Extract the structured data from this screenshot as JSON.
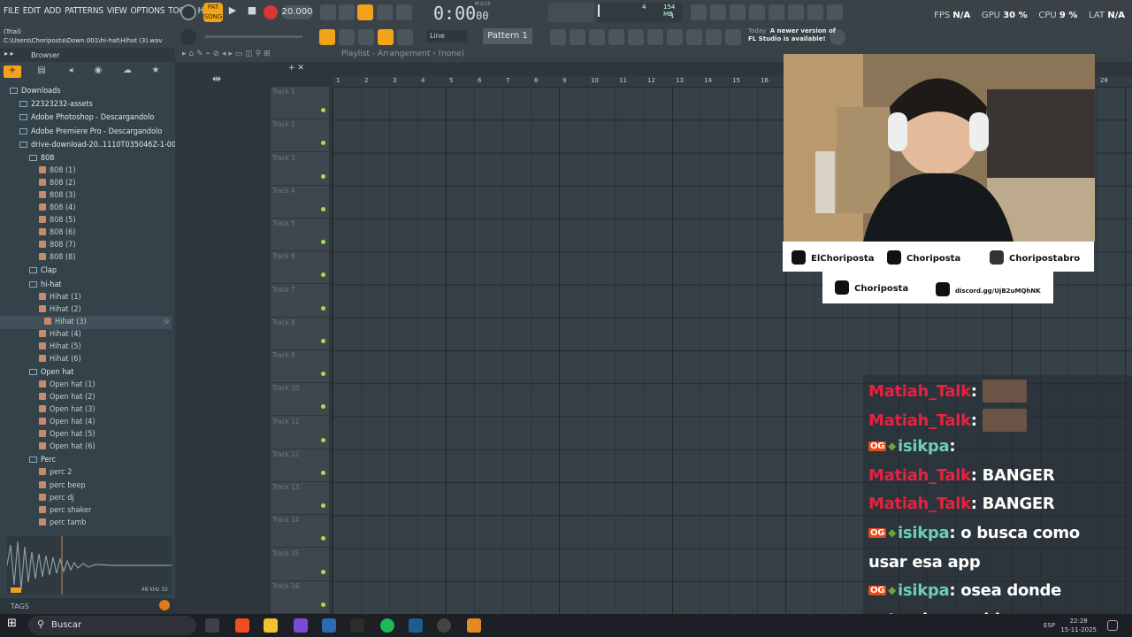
{
  "menubar": {
    "items": [
      "FILE",
      "EDIT",
      "ADD",
      "PATTERNS",
      "VIEW",
      "OPTIONS",
      "TOOLS",
      "HELP"
    ],
    "pat_song": "PAT\nSONG",
    "tempo": "20.000",
    "time": "0:00",
    "time_small": "00",
    "mcs_label": "M:S:CS",
    "memory": "154 MB",
    "cpu_numbers": [
      "4",
      "1"
    ],
    "stats": {
      "fps_label": "FPS",
      "fps": "N/A",
      "gpu_label": "GPU",
      "gpu": "30 %",
      "cpu_label": "CPU",
      "cpu": "9 %",
      "lat_label": "LAT",
      "lat": "N/A"
    }
  },
  "toolbar2": {
    "trial": "(Trial)",
    "path": "C:\\Users\\Choriposta\\Down.001\\hi-hat\\Hihat (3).wav",
    "line_mode": "Line",
    "pattern": "Pattern 1",
    "hint_day": "Today",
    "hint_text": "A newer version of",
    "hint_text2": "FL Studio is available!"
  },
  "browser": {
    "title": "Browser",
    "tags": "TAGS",
    "tree": [
      {
        "label": "Downloads",
        "type": "folder",
        "indent": 1
      },
      {
        "label": "22323232-assets",
        "type": "folder",
        "indent": 2
      },
      {
        "label": "Adobe Photoshop - Descargandolo",
        "type": "folder",
        "indent": 2
      },
      {
        "label": "Adobe Premiere Pro - Descargandolo",
        "type": "folder",
        "indent": 2
      },
      {
        "label": "drive-download-20..1110T035046Z-1-001",
        "type": "folder",
        "indent": 2
      },
      {
        "label": "808",
        "type": "folder",
        "indent": 3
      },
      {
        "label": "808 (1)",
        "type": "audio",
        "indent": 4
      },
      {
        "label": "808 (2)",
        "type": "audio",
        "indent": 4
      },
      {
        "label": "808 (3)",
        "type": "audio",
        "indent": 4
      },
      {
        "label": "808 (4)",
        "type": "audio",
        "indent": 4
      },
      {
        "label": "808 (5)",
        "type": "audio",
        "indent": 4
      },
      {
        "label": "808 (6)",
        "type": "audio",
        "indent": 4
      },
      {
        "label": "808 (7)",
        "type": "audio",
        "indent": 4
      },
      {
        "label": "808 (8)",
        "type": "audio",
        "indent": 4
      },
      {
        "label": "Clap",
        "type": "folder",
        "indent": 3
      },
      {
        "label": "hi-hat",
        "type": "folder",
        "indent": 3
      },
      {
        "label": "Hihat (1)",
        "type": "audio",
        "indent": 4
      },
      {
        "label": "Hihat (2)",
        "type": "audio",
        "indent": 4
      },
      {
        "label": "Hihat (3)",
        "type": "audio",
        "indent": 4,
        "selected": true
      },
      {
        "label": "Hihat (4)",
        "type": "audio",
        "indent": 4
      },
      {
        "label": "Hihat (5)",
        "type": "audio",
        "indent": 4
      },
      {
        "label": "Hihat (6)",
        "type": "audio",
        "indent": 4
      },
      {
        "label": "Open hat",
        "type": "folder",
        "indent": 3
      },
      {
        "label": "Open hat (1)",
        "type": "audio",
        "indent": 4
      },
      {
        "label": "Open hat (2)",
        "type": "audio",
        "indent": 4
      },
      {
        "label": "Open hat (3)",
        "type": "audio",
        "indent": 4
      },
      {
        "label": "Open hat (4)",
        "type": "audio",
        "indent": 4
      },
      {
        "label": "Open hat (5)",
        "type": "audio",
        "indent": 4
      },
      {
        "label": "Open hat (6)",
        "type": "audio",
        "indent": 4
      },
      {
        "label": "Perc",
        "type": "folder",
        "indent": 3
      },
      {
        "label": "perc 2",
        "type": "audio",
        "indent": 4
      },
      {
        "label": "perc beep",
        "type": "audio",
        "indent": 4
      },
      {
        "label": "perc dj",
        "type": "audio",
        "indent": 4
      },
      {
        "label": "perc shaker",
        "type": "audio",
        "indent": 4
      },
      {
        "label": "perc tamb",
        "type": "audio",
        "indent": 4
      }
    ],
    "wave_info": "48 kHz 32"
  },
  "playlist": {
    "title": "Playlist - Arrangement › (none)",
    "ruler": [
      "1",
      "2",
      "3",
      "4",
      "5",
      "6",
      "7",
      "8",
      "9",
      "10",
      "11",
      "12",
      "13",
      "14",
      "15",
      "16",
      "28"
    ],
    "tracks": [
      "Track 1",
      "Track 2",
      "Track 3",
      "Track 4",
      "Track 5",
      "Track 6",
      "Track 7",
      "Track 8",
      "Track 9",
      "Track 10",
      "Track 11",
      "Track 12",
      "Track 13",
      "Track 14",
      "Track 15",
      "Track 16"
    ]
  },
  "overlay": {
    "socials": {
      "instagram": "ElChoriposta",
      "kick": "Choriposta",
      "tiktok": "Choripostabro",
      "twitter": "Choriposta",
      "discord": "discord.gg/UjB2uMQhNK"
    },
    "chat": [
      {
        "user": "Matiah_Talk",
        "text": "",
        "emote": true,
        "team": false,
        "badge": false
      },
      {
        "user": "Matiah_Talk",
        "text": "",
        "emote": true,
        "team": false,
        "badge": false
      },
      {
        "user": "isikpa",
        "text": "",
        "emote": false,
        "team": true,
        "badge": true
      },
      {
        "user": "Matiah_Talk",
        "text": "BANGER",
        "emote": false,
        "team": false,
        "badge": false
      },
      {
        "user": "Matiah_Talk",
        "text": "BANGER",
        "emote": false,
        "team": false,
        "badge": false
      },
      {
        "user": "isikpa",
        "text": "o busca como",
        "emote": false,
        "team": true,
        "badge": true
      },
      {
        "user": "",
        "text": "usar esa app",
        "emote": false,
        "team": false,
        "badge": false
      },
      {
        "user": "isikpa",
        "text": "osea donde",
        "emote": false,
        "team": true,
        "badge": true
      },
      {
        "user": "",
        "text": "estan los sonidos",
        "emote": false,
        "team": false,
        "badge": false
      }
    ],
    "badge_text": "OG"
  },
  "taskbar": {
    "search_placeholder": "Buscar",
    "lang": "ESP",
    "time": "22:28",
    "date": "15-11-2025"
  },
  "colors": {
    "accent": "#f2a31a",
    "track_dot": "#9ee54a",
    "chat_user": "#e8213f",
    "chat_user_alt": "#6cd0b2"
  }
}
